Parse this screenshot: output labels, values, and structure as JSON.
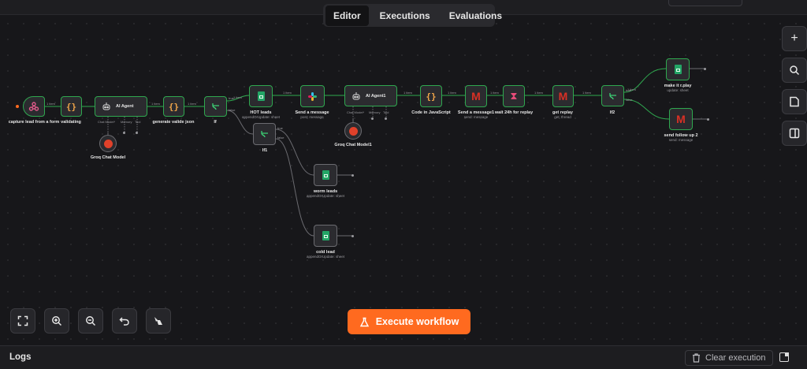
{
  "tabs": [
    {
      "label": "Editor",
      "active": true
    },
    {
      "label": "Executions",
      "active": false
    },
    {
      "label": "Evaluations",
      "active": false
    }
  ],
  "nodes": {
    "capture": {
      "label": "capture lead from a form",
      "icon": "webhook-icon"
    },
    "validating": {
      "label": "validating",
      "icon": "code-braces-icon"
    },
    "ai_agent": {
      "title": "AI Agent",
      "icon": "robot-icon",
      "ports": [
        "Chat Model*",
        "Memory",
        "Tool"
      ]
    },
    "groq1": {
      "label": "Groq Chat Model",
      "icon": "groq-icon"
    },
    "generate_json": {
      "label": "generate valide json",
      "icon": "code-braces-icon"
    },
    "if": {
      "label": "If",
      "icon": "branch-icon",
      "ports": [
        "true",
        "false"
      ]
    },
    "hot_leads": {
      "label": "HOT leads",
      "sub": "appendOrUpdate: sheet",
      "icon": "sheets-icon"
    },
    "if1": {
      "label": "If1",
      "icon": "branch-icon",
      "ports": [
        "true",
        "false"
      ]
    },
    "worm_leads": {
      "label": "worm leads",
      "sub": "appendOrUpdate: sheet",
      "icon": "sheets-icon"
    },
    "cold_lead": {
      "label": "cold lead",
      "sub": "appendOrUpdate: sheet",
      "icon": "sheets-icon"
    },
    "send_message": {
      "label": "Send a message",
      "sub": "post: message",
      "icon": "slack-icon"
    },
    "ai_agent1": {
      "title": "AI Agent1",
      "icon": "robot-icon",
      "ports": [
        "Chat Model*",
        "Memory",
        "Tool"
      ]
    },
    "groq2": {
      "label": "Groq Chat Model1",
      "icon": "groq-icon"
    },
    "code_js": {
      "label": "Code in JavaScript",
      "icon": "code-braces-icon"
    },
    "send_message1": {
      "label": "Send a message1",
      "sub": "send: message",
      "icon": "gmail-icon"
    },
    "wait": {
      "label": "wait 24h for replay",
      "icon": "hourglass-icon"
    },
    "get_replay": {
      "label": "get replay",
      "sub": "get: thread",
      "icon": "gmail-icon"
    },
    "if2": {
      "label": "If2",
      "icon": "branch-icon",
      "ports": [
        "true",
        "false"
      ]
    },
    "make_replay": {
      "label": "make it r.play",
      "sub": "update: sheet",
      "icon": "sheets-icon"
    },
    "follow_up": {
      "label": "send follow up 2",
      "sub": "send: message",
      "icon": "gmail-icon"
    }
  },
  "edge_label": "1 item",
  "toolbar_right": [
    "plus-icon",
    "search-icon",
    "sticky-note-icon",
    "panel-icon"
  ],
  "zoom_controls": [
    "fit-view-icon",
    "zoom-in-icon",
    "zoom-out-icon",
    "undo-icon",
    "tidy-up-icon"
  ],
  "execute_button": "Execute workflow",
  "logs": {
    "title": "Logs",
    "clear_label": "Clear execution"
  },
  "colors": {
    "accent": "#ff6a1f",
    "success": "#2fa84f",
    "sheets": "#23a566",
    "gmail": "#d93025"
  }
}
